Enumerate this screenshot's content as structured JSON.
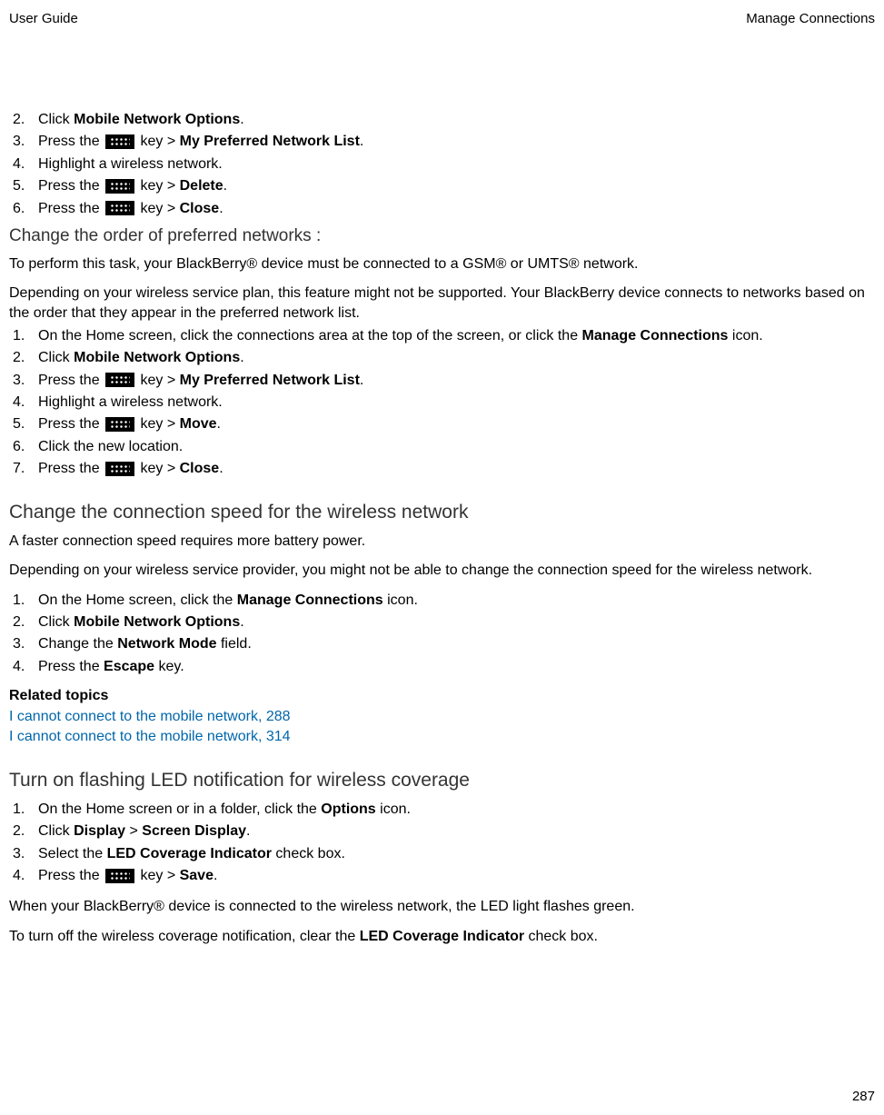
{
  "header": {
    "left": "User Guide",
    "right": "Manage Connections"
  },
  "section1": {
    "items": [
      {
        "num": "2.",
        "prefix": "Click ",
        "bold": "Mobile Network Options",
        "suffix": "."
      },
      {
        "num": "3.",
        "prefix": "Press the ",
        "icon": true,
        "mid": " key > ",
        "bold": "My Preferred Network List",
        "suffix": "."
      },
      {
        "num": "4.",
        "text": "Highlight a wireless network."
      },
      {
        "num": "5.",
        "prefix": "Press the ",
        "icon": true,
        "mid": " key > ",
        "bold": "Delete",
        "suffix": "."
      },
      {
        "num": "6.",
        "prefix": "Press the ",
        "icon": true,
        "mid": " key > ",
        "bold": "Close",
        "suffix": "."
      }
    ]
  },
  "section2": {
    "heading": "Change the order of preferred networks :",
    "para1": "To perform this task, your BlackBerry® device must be connected to a GSM® or UMTS® network.",
    "para2": "Depending on your wireless service plan, this feature might not be supported. Your BlackBerry device connects to networks based on the order that they appear in the preferred network list.",
    "items": [
      {
        "num": "1.",
        "prefix": "On the Home screen, click the connections area at the top of the screen, or click the ",
        "bold": "Manage Connections",
        "suffix": " icon."
      },
      {
        "num": "2.",
        "prefix": "Click ",
        "bold": "Mobile Network Options",
        "suffix": "."
      },
      {
        "num": "3.",
        "prefix": "Press the ",
        "icon": true,
        "mid": " key > ",
        "bold": "My Preferred Network List",
        "suffix": "."
      },
      {
        "num": "4.",
        "text": "Highlight a wireless network."
      },
      {
        "num": "5.",
        "prefix": "Press the ",
        "icon": true,
        "mid": " key > ",
        "bold": "Move",
        "suffix": "."
      },
      {
        "num": "6.",
        "text": "Click the new location."
      },
      {
        "num": "7.",
        "prefix": "Press the ",
        "icon": true,
        "mid": " key > ",
        "bold": "Close",
        "suffix": "."
      }
    ]
  },
  "section3": {
    "heading": "Change the connection speed for the wireless network",
    "para1": "A faster connection speed requires more battery power.",
    "para2": "Depending on your wireless service provider, you might not be able to change the connection speed for the wireless network.",
    "items": [
      {
        "num": "1.",
        "prefix": "On the Home screen, click the ",
        "bold": "Manage Connections",
        "suffix": " icon."
      },
      {
        "num": "2.",
        "prefix": "Click ",
        "bold": "Mobile Network Options",
        "suffix": "."
      },
      {
        "num": "3.",
        "prefix": "Change the ",
        "bold": "Network Mode",
        "suffix": " field."
      },
      {
        "num": "4.",
        "prefix": "Press the ",
        "bold": "Escape",
        "suffix": " key."
      }
    ],
    "related_label": "Related topics",
    "links": [
      "I cannot connect to the mobile network, 288",
      "I cannot connect to the mobile network, 314"
    ]
  },
  "section4": {
    "heading": "Turn on flashing LED notification for wireless coverage",
    "items": [
      {
        "num": "1.",
        "prefix": "On the Home screen or in a folder, click the ",
        "bold": "Options",
        "suffix": " icon."
      },
      {
        "num": "2.",
        "prefix": "Click ",
        "bold": "Display",
        "mid2": " > ",
        "bold2": "Screen Display",
        "suffix": "."
      },
      {
        "num": "3.",
        "prefix": "Select the ",
        "bold": "LED Coverage Indicator",
        "suffix": " check box."
      },
      {
        "num": "4.",
        "prefix": "Press the ",
        "icon": true,
        "mid": " key > ",
        "bold": "Save",
        "suffix": "."
      }
    ],
    "para1": "When your BlackBerry® device is connected to the wireless network, the LED light flashes green.",
    "para2_prefix": "To turn off the wireless coverage notification, clear the ",
    "para2_bold": "LED Coverage Indicator",
    "para2_suffix": " check box."
  },
  "page_number": "287"
}
